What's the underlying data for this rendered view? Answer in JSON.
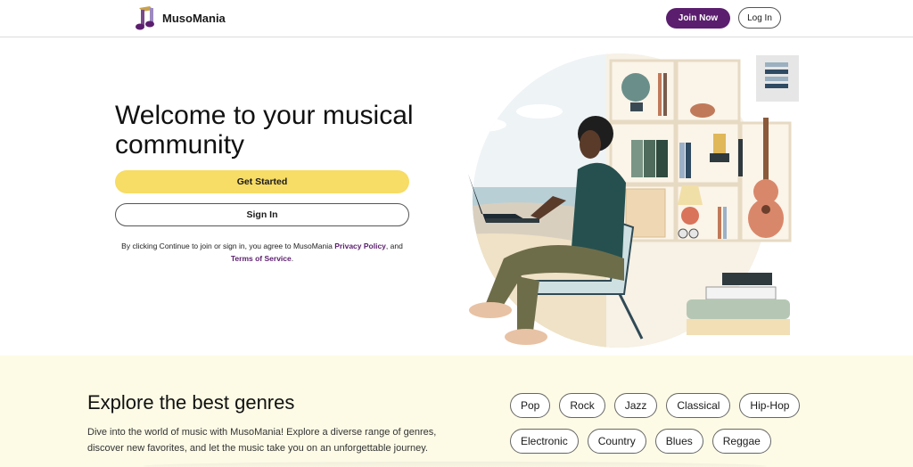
{
  "header": {
    "brand": "MusoMania",
    "join_label": "Join Now",
    "login_label": "Log In",
    "brand_color": "#5b1e6e"
  },
  "hero": {
    "title": "Welcome to your musical community",
    "get_started_label": "Get Started",
    "sign_in_label": "Sign In",
    "legal_prefix": "By clicking Continue to join or sign in, you agree to MusoMania ",
    "privacy_label": "Privacy Policy",
    "legal_mid": ", and ",
    "terms_label": "Terms of Service",
    "legal_suffix": ".",
    "accent_color": "#f7dc65"
  },
  "genres": {
    "title": "Explore the best genres",
    "description": "Dive into the world of music with MusoMania! Explore a diverse range of genres, discover new favorites, and let the music take you on an unforgettable journey.",
    "row1": [
      "Pop",
      "Rock",
      "Jazz",
      "Classical",
      "Hip-Hop"
    ],
    "row2": [
      "Electronic",
      "Country",
      "Blues",
      "Reggae"
    ],
    "background_color": "#fdfbe6"
  },
  "icons": {
    "logo": "music-notes-icon"
  }
}
